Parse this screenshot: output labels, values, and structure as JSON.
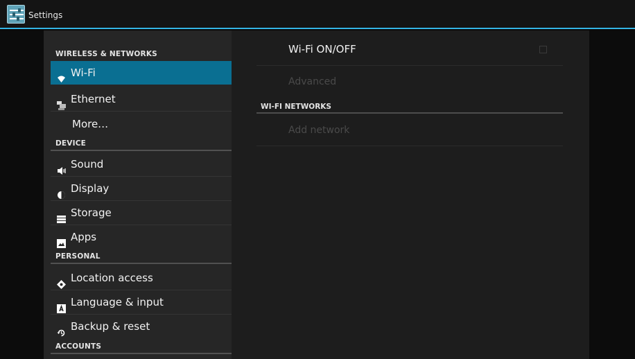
{
  "actionbar": {
    "title": "Settings",
    "accent_color": "#33b5e5",
    "icon": "settings-sliders-icon"
  },
  "sidebar": {
    "selected_color": "#0a6f92",
    "sections": {
      "wireless": "WIRELESS & NETWORKS",
      "device": "DEVICE",
      "personal": "PERSONAL",
      "accounts": "ACCOUNTS"
    },
    "items": [
      {
        "label": "Wi-Fi",
        "icon": "wifi-icon",
        "selected": true
      },
      {
        "label": "Ethernet",
        "icon": "ethernet-icon",
        "selected": false
      },
      {
        "label": "More…",
        "icon": "",
        "selected": false
      },
      {
        "label": "Sound",
        "icon": "speaker-icon",
        "selected": false
      },
      {
        "label": "Display",
        "icon": "display-icon",
        "selected": false
      },
      {
        "label": "Storage",
        "icon": "storage-icon",
        "selected": false
      },
      {
        "label": "Apps",
        "icon": "apps-icon",
        "selected": false
      },
      {
        "label": "Location access",
        "icon": "location-icon",
        "selected": false
      },
      {
        "label": "Language & input",
        "icon": "keyboard-icon",
        "selected": false
      },
      {
        "label": "Backup & reset",
        "icon": "backup-icon",
        "selected": false
      }
    ]
  },
  "detail": {
    "wifi_toggle": {
      "label": "Wi-Fi ON/OFF",
      "checked": false
    },
    "advanced": {
      "label": "Advanced",
      "enabled": false
    },
    "networks_header": "WI-FI NETWORKS",
    "add_network": {
      "label": "Add network",
      "enabled": false
    }
  }
}
